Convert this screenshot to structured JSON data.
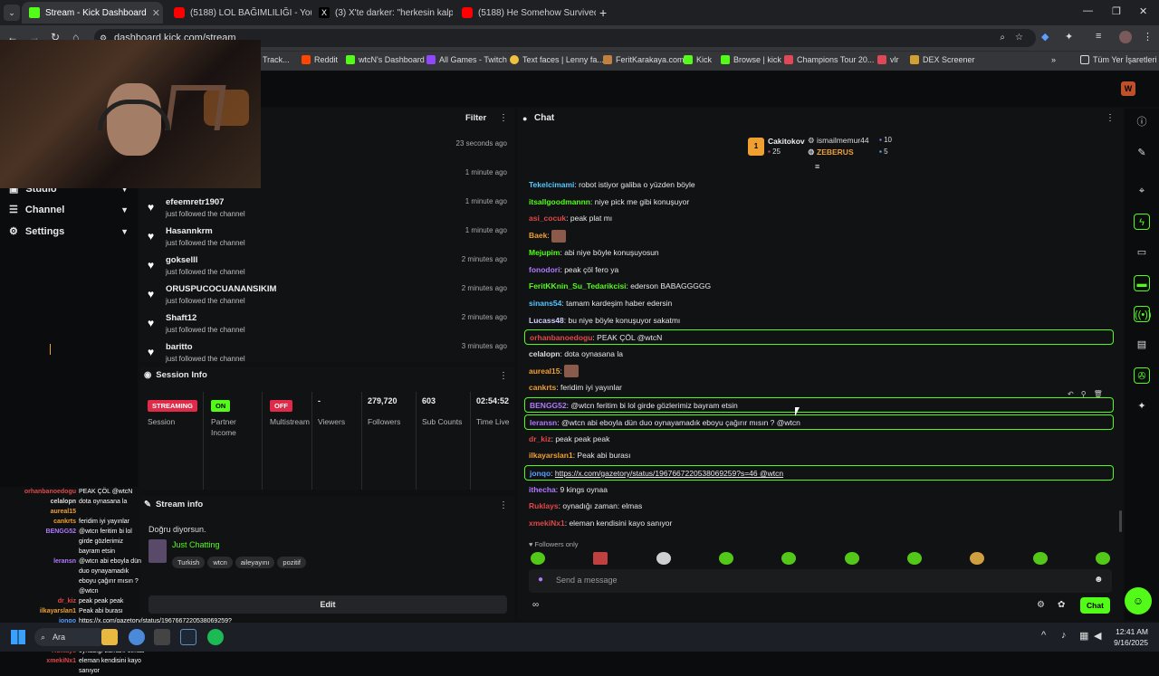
{
  "browser": {
    "tabs": [
      {
        "label": "Stream - Kick Dashboard",
        "icon": "kick-icon",
        "active": true
      },
      {
        "label": "(5188) LOL BAĞIMLILIĞI - YouTu",
        "icon": "youtube-icon"
      },
      {
        "label": "(3) X'te darker: \"herkesin kalpte",
        "icon": "x-icon"
      },
      {
        "label": "(5188) He Somehow Survived T",
        "icon": "youtube-icon"
      }
    ],
    "url": "dashboard.kick.com/stream",
    "bookmarks": [
      "Track...",
      "Reddit",
      "wtcN's Dashboard",
      "All Games - Twitch",
      "Text faces | Lenny fa...",
      "FeritKarakaya.com",
      "Kick",
      "Browse | kick",
      "Champions Tour 20...",
      "vlr",
      "DEX Screener"
    ],
    "bookmarks_folder": "Tüm Yer İşaretleri"
  },
  "nav": {
    "items": [
      {
        "label": "Studio",
        "icon": "studio-icon"
      },
      {
        "label": "Channel",
        "icon": "channel-icon"
      },
      {
        "label": "Settings",
        "icon": "gear-icon"
      }
    ]
  },
  "activity": {
    "filter_label": "Filter",
    "rows": [
      {
        "user": "",
        "action": "",
        "time": "23 seconds ago"
      },
      {
        "user": "",
        "action": "",
        "time": "1 minute ago"
      },
      {
        "user": "efeemretr1907",
        "action": "just followed the channel",
        "time": "1 minute ago"
      },
      {
        "user": "Hasannkrm",
        "action": "just followed the channel",
        "time": "1 minute ago"
      },
      {
        "user": "gokselll",
        "action": "just followed the channel",
        "time": "2 minutes ago"
      },
      {
        "user": "ORUSPUCOCUANANSIKIM",
        "action": "just followed the channel",
        "time": "2 minutes ago"
      },
      {
        "user": "Shaft12",
        "action": "just followed the channel",
        "time": "2 minutes ago"
      },
      {
        "user": "baritto",
        "action": "just followed the channel",
        "time": "3 minutes ago"
      }
    ]
  },
  "session": {
    "title": "Session Info",
    "cols": [
      {
        "badge": "STREAMING",
        "label": "Session",
        "badge_color": "#e02a48"
      },
      {
        "badge": "ON",
        "label": "Partner Income",
        "badge_color": "#53fc18"
      },
      {
        "badge": "OFF",
        "label": "Multistream",
        "badge_color": "#e02a48"
      },
      {
        "value": "-",
        "label": "Viewers"
      },
      {
        "value": "279,720",
        "label": "Followers"
      },
      {
        "value": "603",
        "label": "Sub Counts"
      },
      {
        "value": "02:54:52",
        "label": "Time Live"
      }
    ]
  },
  "stream_info": {
    "title": "Stream info",
    "stream_title": "Doğru diyorsun.",
    "category": "Just Chatting",
    "tags": [
      "Turkish",
      "wtcn",
      "aileyayını",
      "pozitif"
    ],
    "edit_label": "Edit"
  },
  "overlay_chat": [
    {
      "user": "orhanbanoedogu",
      "msg": "PEAK ÇÖL @wtcN",
      "color": "#e04848"
    },
    {
      "user": "celalopn",
      "msg": "dota oynasana la",
      "color": "#dddddd"
    },
    {
      "user": "aureal15",
      "msg": "",
      "color": "#f0a030"
    },
    {
      "user": "cankrts",
      "msg": "feridim iyi yayınlar",
      "color": "#f0a030"
    },
    {
      "user": "BENGG52",
      "msg": "@wtcn feritim bi lol girde gözlerimiz bayram etsin",
      "color": "#b07aff"
    },
    {
      "user": "leransn",
      "msg": "@wtcn abi eboyla dün duo oynayamadık eboyu çağırır mısın ? @wtcn",
      "color": "#b07aff"
    },
    {
      "user": "dr_kiz",
      "msg": "peak peak peak",
      "color": "#e04848"
    },
    {
      "user": "ilkayarslan1",
      "msg": "Peak abi burası",
      "color": "#f0a030"
    },
    {
      "user": "jonqo",
      "msg": "https://x.com/gazetory/status/1967667220538069259?s=46 @wtcn",
      "color": "#5aa0ff"
    },
    {
      "user": "ithecha",
      "msg": "9 kings oynaa",
      "color": "#b07aff"
    },
    {
      "user": "Ruklays",
      "msg": "oynadığı zaman: elmas",
      "color": "#e04848"
    },
    {
      "user": "xmekiNx1",
      "msg": "eleman kendisini kayo sanıyor",
      "color": "#e04848"
    }
  ],
  "chat": {
    "title": "Chat",
    "leaderboard": [
      {
        "name": "Cakitokov",
        "value": "25",
        "rank": "1"
      },
      {
        "name": "ismailmemur44",
        "value": "10"
      },
      {
        "name": "ZEBERUS",
        "value": "5"
      }
    ],
    "messages": [
      {
        "user": "Tekelcimami",
        "text": "robot istiyor galiba o yüzden böyle",
        "color": "#53c8ff"
      },
      {
        "user": "itsallgoodmannn",
        "text": "niye pick me gibi konuşuyor",
        "color": "#53fc18"
      },
      {
        "user": "asi_cocuk",
        "text": "peak plat mı",
        "color": "#e04848"
      },
      {
        "user": "Baek",
        "text": "",
        "color": "#f0a030",
        "emote": true
      },
      {
        "user": "Mejupim",
        "text": "abi niye böyle konuşuyosun",
        "color": "#53fc18"
      },
      {
        "user": "fonodori",
        "text": "peak çöl fero ya",
        "color": "#b07aff"
      },
      {
        "user": "FeritKKnin_Su_Tedarikcisi",
        "text": "ederson BABAGGGGG",
        "color": "#53fc18"
      },
      {
        "user": "sinans54",
        "text": "tamam kardeşim haber edersin",
        "color": "#53c8ff"
      },
      {
        "user": "Lucass48",
        "text": "bu niye böyle konuşuyor sakatmı",
        "color": "#d0d0ff"
      },
      {
        "user": "orhanbanoedogu",
        "text": "PEAK ÇÖL @wtcN",
        "color": "#e04848",
        "hl": true
      },
      {
        "user": "celalopn",
        "text": "dota oynasana la",
        "color": "#dddddd"
      },
      {
        "user": "aureal15",
        "text": "",
        "color": "#f0a030",
        "emote": true
      },
      {
        "user": "cankrts",
        "text": "feridim iyi yayınlar",
        "color": "#f0a030"
      },
      {
        "user": "BENGG52",
        "text": "@wtcn feritim bi lol girde gözlerimiz bayram etsin",
        "color": "#b07aff",
        "hl": true
      },
      {
        "user": "leransn",
        "text": "@wtcn abi eboyla dün duo oynayamadık eboyu çağırır mısın ? @wtcn",
        "color": "#b07aff",
        "hl": true
      },
      {
        "user": "dr_kiz",
        "text": "peak peak peak",
        "color": "#e04848"
      },
      {
        "user": "ilkayarslan1",
        "text": "Peak abi burası",
        "color": "#f0a030"
      },
      {
        "user": "jonqo",
        "text": "https://x.com/gazetory/status/1967667220538069259?s=46 @wtcn",
        "color": "#5aa0ff",
        "hl": true
      },
      {
        "user": "ithecha",
        "text": "9 kings oynaa",
        "color": "#b07aff"
      },
      {
        "user": "Ruklays",
        "text": "oynadığı zaman: elmas",
        "color": "#e04848"
      },
      {
        "user": "xmekiNx1",
        "text": "eleman kendisini kayo sanıyor",
        "color": "#e04848"
      }
    ],
    "followers_only": "Followers only",
    "input_placeholder": "Send a message",
    "send_label": "Chat"
  },
  "taskbar": {
    "search_label": "Ara",
    "time": "12:41 AM",
    "date": "9/16/2025"
  }
}
